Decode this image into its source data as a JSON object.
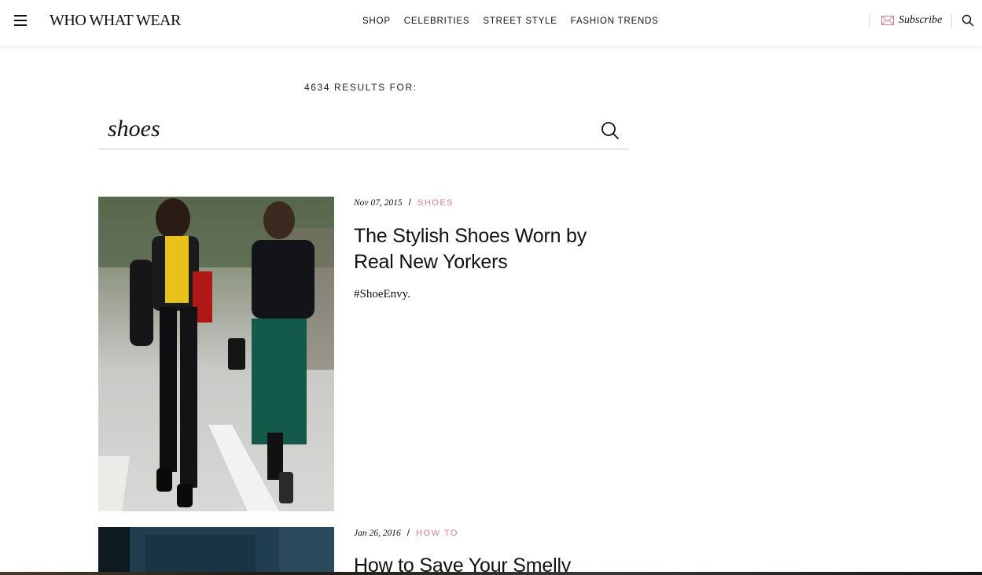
{
  "header": {
    "logo": "WHO WHAT WEAR",
    "nav": [
      "SHOP",
      "CELEBRITIES",
      "STREET STYLE",
      "FASHION TRENDS"
    ],
    "subscribe_label": "Subscribe"
  },
  "search": {
    "results_count": "4634 RESULTS FOR:",
    "query": "shoes"
  },
  "articles": [
    {
      "date": "Nov 07, 2015",
      "category": "SHOES",
      "title": "The Stylish Shoes Worn by Real New Yorkers",
      "dek": "#ShoeEnvy."
    },
    {
      "date": "Jan 26, 2016",
      "category": "HOW TO",
      "title": "How to Save Your Smelly"
    }
  ],
  "colors": {
    "accent": "#e07b93",
    "text": "#111111"
  }
}
